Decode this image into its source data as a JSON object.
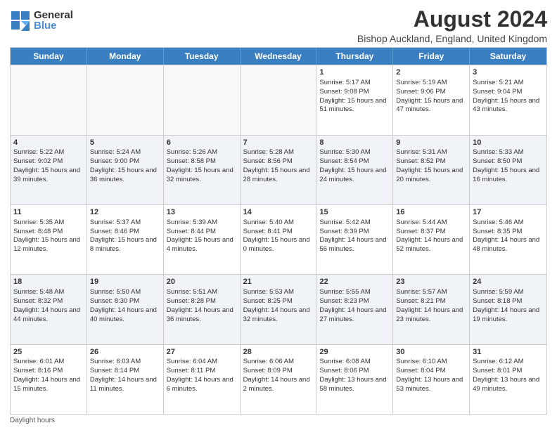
{
  "logo": {
    "general": "General",
    "blue": "Blue"
  },
  "title": "August 2024",
  "subtitle": "Bishop Auckland, England, United Kingdom",
  "days": [
    "Sunday",
    "Monday",
    "Tuesday",
    "Wednesday",
    "Thursday",
    "Friday",
    "Saturday"
  ],
  "rows": [
    [
      {
        "day": "",
        "sunrise": "",
        "sunset": "",
        "daylight": "",
        "empty": true
      },
      {
        "day": "",
        "sunrise": "",
        "sunset": "",
        "daylight": "",
        "empty": true
      },
      {
        "day": "",
        "sunrise": "",
        "sunset": "",
        "daylight": "",
        "empty": true
      },
      {
        "day": "",
        "sunrise": "",
        "sunset": "",
        "daylight": "",
        "empty": true
      },
      {
        "day": "1",
        "sunrise": "Sunrise: 5:17 AM",
        "sunset": "Sunset: 9:08 PM",
        "daylight": "Daylight: 15 hours and 51 minutes."
      },
      {
        "day": "2",
        "sunrise": "Sunrise: 5:19 AM",
        "sunset": "Sunset: 9:06 PM",
        "daylight": "Daylight: 15 hours and 47 minutes."
      },
      {
        "day": "3",
        "sunrise": "Sunrise: 5:21 AM",
        "sunset": "Sunset: 9:04 PM",
        "daylight": "Daylight: 15 hours and 43 minutes."
      }
    ],
    [
      {
        "day": "4",
        "sunrise": "Sunrise: 5:22 AM",
        "sunset": "Sunset: 9:02 PM",
        "daylight": "Daylight: 15 hours and 39 minutes."
      },
      {
        "day": "5",
        "sunrise": "Sunrise: 5:24 AM",
        "sunset": "Sunset: 9:00 PM",
        "daylight": "Daylight: 15 hours and 36 minutes."
      },
      {
        "day": "6",
        "sunrise": "Sunrise: 5:26 AM",
        "sunset": "Sunset: 8:58 PM",
        "daylight": "Daylight: 15 hours and 32 minutes."
      },
      {
        "day": "7",
        "sunrise": "Sunrise: 5:28 AM",
        "sunset": "Sunset: 8:56 PM",
        "daylight": "Daylight: 15 hours and 28 minutes."
      },
      {
        "day": "8",
        "sunrise": "Sunrise: 5:30 AM",
        "sunset": "Sunset: 8:54 PM",
        "daylight": "Daylight: 15 hours and 24 minutes."
      },
      {
        "day": "9",
        "sunrise": "Sunrise: 5:31 AM",
        "sunset": "Sunset: 8:52 PM",
        "daylight": "Daylight: 15 hours and 20 minutes."
      },
      {
        "day": "10",
        "sunrise": "Sunrise: 5:33 AM",
        "sunset": "Sunset: 8:50 PM",
        "daylight": "Daylight: 15 hours and 16 minutes."
      }
    ],
    [
      {
        "day": "11",
        "sunrise": "Sunrise: 5:35 AM",
        "sunset": "Sunset: 8:48 PM",
        "daylight": "Daylight: 15 hours and 12 minutes."
      },
      {
        "day": "12",
        "sunrise": "Sunrise: 5:37 AM",
        "sunset": "Sunset: 8:46 PM",
        "daylight": "Daylight: 15 hours and 8 minutes."
      },
      {
        "day": "13",
        "sunrise": "Sunrise: 5:39 AM",
        "sunset": "Sunset: 8:44 PM",
        "daylight": "Daylight: 15 hours and 4 minutes."
      },
      {
        "day": "14",
        "sunrise": "Sunrise: 5:40 AM",
        "sunset": "Sunset: 8:41 PM",
        "daylight": "Daylight: 15 hours and 0 minutes."
      },
      {
        "day": "15",
        "sunrise": "Sunrise: 5:42 AM",
        "sunset": "Sunset: 8:39 PM",
        "daylight": "Daylight: 14 hours and 56 minutes."
      },
      {
        "day": "16",
        "sunrise": "Sunrise: 5:44 AM",
        "sunset": "Sunset: 8:37 PM",
        "daylight": "Daylight: 14 hours and 52 minutes."
      },
      {
        "day": "17",
        "sunrise": "Sunrise: 5:46 AM",
        "sunset": "Sunset: 8:35 PM",
        "daylight": "Daylight: 14 hours and 48 minutes."
      }
    ],
    [
      {
        "day": "18",
        "sunrise": "Sunrise: 5:48 AM",
        "sunset": "Sunset: 8:32 PM",
        "daylight": "Daylight: 14 hours and 44 minutes."
      },
      {
        "day": "19",
        "sunrise": "Sunrise: 5:50 AM",
        "sunset": "Sunset: 8:30 PM",
        "daylight": "Daylight: 14 hours and 40 minutes."
      },
      {
        "day": "20",
        "sunrise": "Sunrise: 5:51 AM",
        "sunset": "Sunset: 8:28 PM",
        "daylight": "Daylight: 14 hours and 36 minutes."
      },
      {
        "day": "21",
        "sunrise": "Sunrise: 5:53 AM",
        "sunset": "Sunset: 8:25 PM",
        "daylight": "Daylight: 14 hours and 32 minutes."
      },
      {
        "day": "22",
        "sunrise": "Sunrise: 5:55 AM",
        "sunset": "Sunset: 8:23 PM",
        "daylight": "Daylight: 14 hours and 27 minutes."
      },
      {
        "day": "23",
        "sunrise": "Sunrise: 5:57 AM",
        "sunset": "Sunset: 8:21 PM",
        "daylight": "Daylight: 14 hours and 23 minutes."
      },
      {
        "day": "24",
        "sunrise": "Sunrise: 5:59 AM",
        "sunset": "Sunset: 8:18 PM",
        "daylight": "Daylight: 14 hours and 19 minutes."
      }
    ],
    [
      {
        "day": "25",
        "sunrise": "Sunrise: 6:01 AM",
        "sunset": "Sunset: 8:16 PM",
        "daylight": "Daylight: 14 hours and 15 minutes."
      },
      {
        "day": "26",
        "sunrise": "Sunrise: 6:03 AM",
        "sunset": "Sunset: 8:14 PM",
        "daylight": "Daylight: 14 hours and 11 minutes."
      },
      {
        "day": "27",
        "sunrise": "Sunrise: 6:04 AM",
        "sunset": "Sunset: 8:11 PM",
        "daylight": "Daylight: 14 hours and 6 minutes."
      },
      {
        "day": "28",
        "sunrise": "Sunrise: 6:06 AM",
        "sunset": "Sunset: 8:09 PM",
        "daylight": "Daylight: 14 hours and 2 minutes."
      },
      {
        "day": "29",
        "sunrise": "Sunrise: 6:08 AM",
        "sunset": "Sunset: 8:06 PM",
        "daylight": "Daylight: 13 hours and 58 minutes."
      },
      {
        "day": "30",
        "sunrise": "Sunrise: 6:10 AM",
        "sunset": "Sunset: 8:04 PM",
        "daylight": "Daylight: 13 hours and 53 minutes."
      },
      {
        "day": "31",
        "sunrise": "Sunrise: 6:12 AM",
        "sunset": "Sunset: 8:01 PM",
        "daylight": "Daylight: 13 hours and 49 minutes."
      }
    ]
  ],
  "footer": {
    "daylight_hours_label": "Daylight hours"
  }
}
